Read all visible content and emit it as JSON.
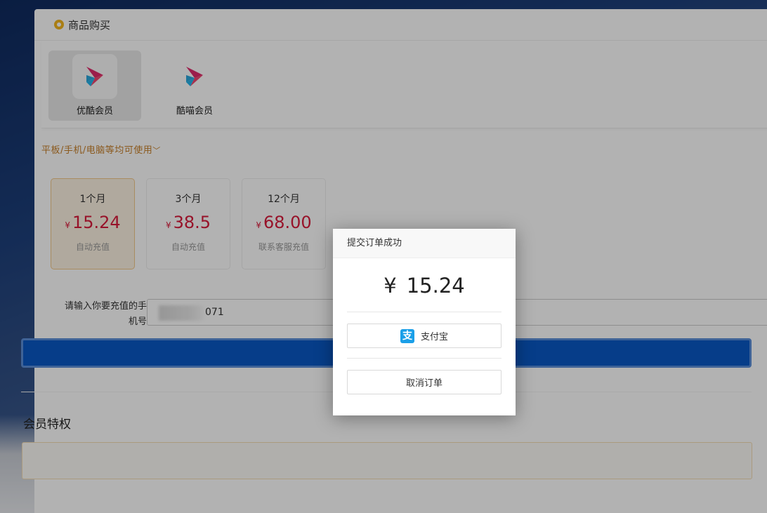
{
  "header": {
    "title": "商品购买"
  },
  "products": [
    {
      "name": "优酷会员",
      "selected": true
    },
    {
      "name": "酷喵会员",
      "selected": false
    }
  ],
  "device_note": "平板/手机/电脑等均可使用",
  "plans": [
    {
      "name": "1个月",
      "currency": "¥",
      "price": "15.24",
      "note": "自动充值",
      "selected": true
    },
    {
      "name": "3个月",
      "currency": "¥",
      "price": "38.5",
      "note": "自动充值",
      "selected": false
    },
    {
      "name": "12个月",
      "currency": "¥",
      "price": "68.00",
      "note": "联系客服充值",
      "selected": false
    }
  ],
  "phone": {
    "label": "请输入你要充值的手机号",
    "value_suffix": "071"
  },
  "privileges": {
    "title": "会员特权"
  },
  "modal": {
    "title": "提交订单成功",
    "currency": "¥",
    "amount": "15.24",
    "alipay_label": "支付宝",
    "alipay_icon_glyph": "支",
    "cancel_label": "取消订单"
  },
  "colors": {
    "accent_price": "#d91b3b",
    "submit_blue": "#0a58c5",
    "note_orange": "#c7802a",
    "alipay_blue": "#1a9fe8"
  }
}
